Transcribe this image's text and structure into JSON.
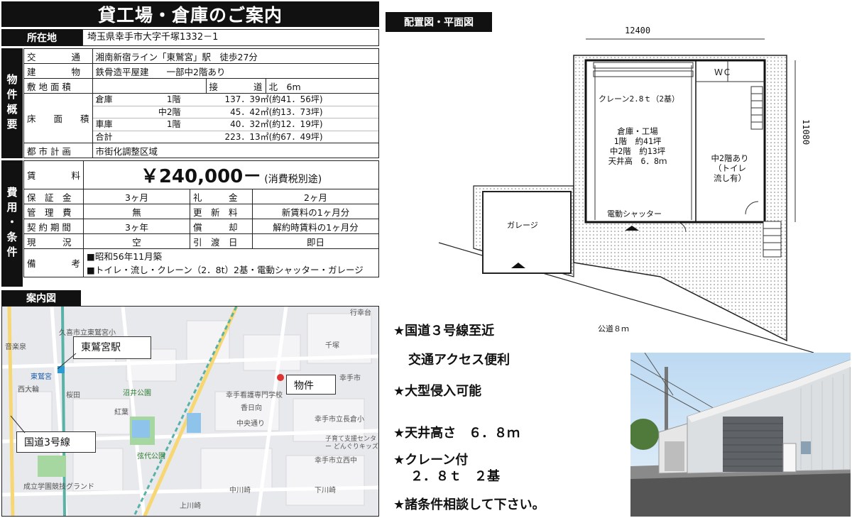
{
  "title": "貸工場・倉庫のご案内",
  "location": {
    "label": "所在地",
    "value": "埼玉県幸手市大字千塚1332－1"
  },
  "property_section": {
    "label": "物件概要",
    "transport": {
      "label": "交　　　　通",
      "value": "湘南新宿ライン「東鷲宮」駅　徒歩27分"
    },
    "structure": {
      "label": "建　　　　物",
      "value": "鉄骨造平屋建　　一部中2階あり"
    },
    "land": {
      "label": "敷 地 面 積",
      "value": "",
      "road_label": "接　　　　道",
      "road_value": "北　6m"
    },
    "floor": {
      "label": "床　　面　　積",
      "rows": [
        {
          "a": "倉庫",
          "b": "1階",
          "c": "137．39㎡(約41．56坪)"
        },
        {
          "a": "",
          "b": "中2階",
          "c": "45．42㎡(約13．73坪)"
        },
        {
          "a": "車庫",
          "b": "1階",
          "c": "40．32㎡(約12．19坪)"
        },
        {
          "a": "合計",
          "b": "",
          "c": "223．13㎡(約67．49坪)"
        }
      ]
    },
    "planning": {
      "label": "都 市 計 画",
      "value": "市街化調整区域"
    }
  },
  "cost_section": {
    "label": "費用・条件",
    "rent": {
      "label": "賃　　　　料",
      "value": "￥240,000－",
      "tax": "(消費税別途)"
    },
    "rows": [
      {
        "l1": "保　証　金",
        "v1": "3ヶ月",
        "l2": "礼　　　金",
        "v2": "2ヶ月"
      },
      {
        "l1": "管　理　費",
        "v1": "無",
        "l2": "更　新　料",
        "v2": "新賃料の1ヶ月分"
      },
      {
        "l1": "契 約 期 間",
        "v1": "3ヶ年",
        "l2": "償　　　却",
        "v2": "解約時賃料の1ヶ月分"
      },
      {
        "l1": "現　　　況",
        "v1": "空",
        "l2": "引　渡　日",
        "v2": "即日"
      }
    ],
    "remarks": {
      "label": "備　　　　考",
      "line1": "■昭和56年11月築",
      "line2": "■トイレ・流し・クレーン（2．8t）2基・電動シャッター・ガレージ"
    }
  },
  "map": {
    "label": "案内図",
    "callout_station": "東鷲宮駅",
    "callout_property": "物件",
    "callout_route": "国道3号線",
    "place_labels": [
      "久喜市立東鷲宮小",
      "千塚",
      "幸手市",
      "東鷲宮",
      "桜田",
      "沼井公園",
      "紅葉",
      "香日向",
      "中央通り",
      "幸手看護専門学校",
      "幸手市立長倉小",
      "弦代公園",
      "成立学園競技グランド",
      "上川崎",
      "中川崎",
      "下川崎",
      "音楽泉",
      "西大輪",
      "行幸台",
      "幸手市立西中",
      "子育て支援センター どんぐりキッズ"
    ]
  },
  "plan": {
    "label": "配置図・平面図",
    "width_dim": "12400",
    "height_dim": "11080",
    "wc": "ＷＣ",
    "crane": "クレーン2.8ｔ（2基）",
    "warehouse": [
      "倉庫・工場",
      "1階　約41坪",
      "中2階　約13坪",
      "天井高　6．8ｍ"
    ],
    "mezzanine": [
      "中2階あり",
      "（トイレ",
      "流し有）"
    ],
    "shutter": "電動シャッター",
    "garage": "ガレージ",
    "road": "公道８ｍ"
  },
  "features": [
    "★国道３号線至近",
    "交通アクセス便利",
    "★大型侵入可能",
    "★天井高さ　６．８ｍ",
    "★クレーン付",
    "２．８ｔ　２基",
    "★諸条件相談して下さい。"
  ],
  "colors": {
    "header": "#111111",
    "map_bg": "#e8e9ec",
    "park": "#a6d7a0",
    "water": "#8ec3ec",
    "rail": "#58b3a6"
  }
}
